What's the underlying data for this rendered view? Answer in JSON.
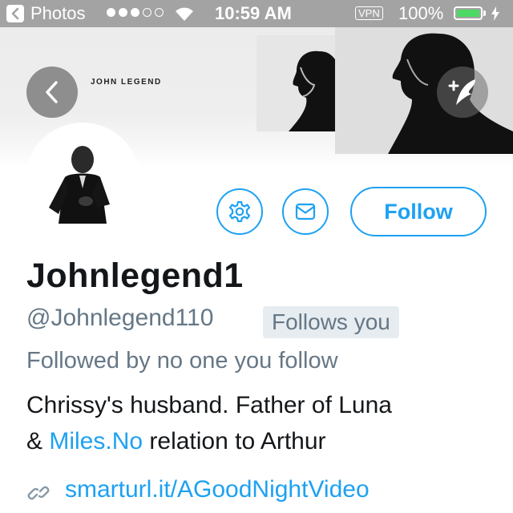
{
  "status_bar": {
    "back_app": "Photos",
    "time": "10:59 AM",
    "vpn": "VPN",
    "battery": "100%",
    "signal_dots": 5,
    "signal_filled": 3,
    "battery_color": "#4cd964"
  },
  "header": {
    "banner_logo": "JOHN LEGEND"
  },
  "actions": {
    "follow_label": "Follow",
    "accent_color": "#1da1f2"
  },
  "profile": {
    "display_name": "Johnlegend1",
    "handle": "@Johnlegend110",
    "follows_you": "Follows you",
    "followed_by": "Followed by no one you follow",
    "bio_line1": "Chrissy's husband. Father of Luna",
    "bio_amp": "& ",
    "bio_link": "Miles.No",
    "bio_rest": " relation to Arthur",
    "url": "smarturl.it/AGoodNightVideo"
  },
  "icons": [
    "back-chevron-icon",
    "compose-icon",
    "gear-icon",
    "envelope-icon",
    "link-icon",
    "wifi-icon",
    "bolt-icon"
  ]
}
